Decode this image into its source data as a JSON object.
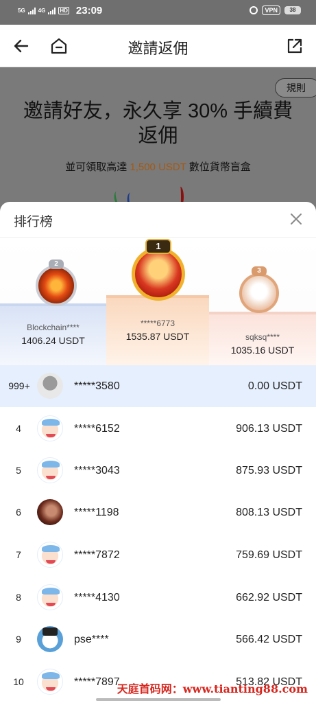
{
  "status_bar": {
    "net1": "5G",
    "net2": "4G",
    "hd": "HD",
    "time": "23:09",
    "vpn": "VPN",
    "battery": "38"
  },
  "header": {
    "title": "邀請返佣",
    "back_icon": "arrow-left-icon",
    "home_icon": "home-icon",
    "share_icon": "share-icon"
  },
  "banner": {
    "rules": "規則",
    "headline": "邀請好友，永久享 30% 手續費返佣",
    "sub_prefix": "並可領取高達 ",
    "sub_highlight": "1,500 USDT",
    "sub_suffix": " 數位貨幣盲盒",
    "highlight_color": "#a35a16"
  },
  "leaderboard": {
    "title": "排行榜",
    "close_icon": "close-icon",
    "podium": [
      {
        "rank": "2",
        "name": "Blockchain****",
        "amount": "1406.24 USDT"
      },
      {
        "rank": "1",
        "name": "*****6773",
        "amount": "1535.87 USDT"
      },
      {
        "rank": "3",
        "name": "sqksq****",
        "amount": "1035.16 USDT"
      }
    ],
    "me": {
      "rank": "999+",
      "name": "*****3580",
      "amount": "0.00 USDT"
    },
    "rows": [
      {
        "rank": "4",
        "name": "*****6152",
        "amount": "906.13 USDT"
      },
      {
        "rank": "5",
        "name": "*****3043",
        "amount": "875.93 USDT"
      },
      {
        "rank": "6",
        "name": "*****1198",
        "amount": "808.13 USDT"
      },
      {
        "rank": "7",
        "name": "*****7872",
        "amount": "759.69 USDT"
      },
      {
        "rank": "8",
        "name": "*****4130",
        "amount": "662.92 USDT"
      },
      {
        "rank": "9",
        "name": "pse****",
        "amount": "566.42 USDT"
      },
      {
        "rank": "10",
        "name": "*****7897",
        "amount": "513.82 USDT"
      }
    ]
  },
  "watermark": "天庭首码网：www.tianting88.com"
}
